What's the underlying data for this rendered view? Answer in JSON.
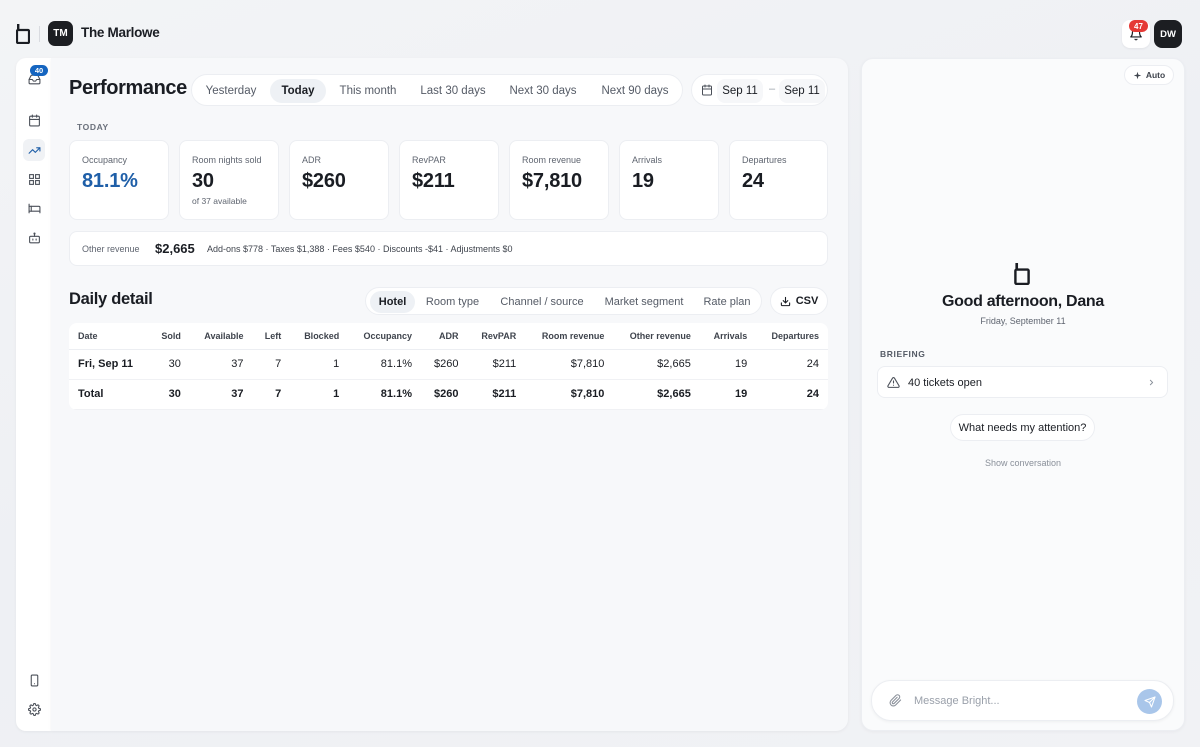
{
  "topbar": {
    "workspace_initials": "TM",
    "workspace_name": "The Marlowe",
    "notifications_count": "47",
    "user_initials": "DW"
  },
  "rail": {
    "inbox_badge": "40",
    "items": [
      "inbox-icon",
      "calendar-icon",
      "trending-up-icon",
      "grid-icon",
      "bed-icon",
      "robot-icon"
    ],
    "bottom_items": [
      "mobile-icon",
      "gear-icon"
    ]
  },
  "header": {
    "title": "Performance",
    "range_tabs": [
      "Yesterday",
      "Today",
      "This month",
      "Last 30 days",
      "Next 30 days",
      "Next 90 days"
    ],
    "active_range": "Today",
    "date_from": "Sep 11",
    "date_sep": "–",
    "date_to": "Sep 11"
  },
  "summary": {
    "section_label": "TODAY",
    "cards": [
      {
        "label": "Occupancy",
        "value": "81.1%"
      },
      {
        "label": "Room nights sold",
        "value": "30",
        "sub": "of 37 available"
      },
      {
        "label": "ADR",
        "value": "$260"
      },
      {
        "label": "RevPAR",
        "value": "$211"
      },
      {
        "label": "Room revenue",
        "value": "$7,810"
      },
      {
        "label": "Arrivals",
        "value": "19"
      },
      {
        "label": "Departures",
        "value": "24"
      }
    ],
    "other_revenue": {
      "label": "Other revenue",
      "amount": "$2,665",
      "breakdown": "Add-ons $778 · Taxes $1,388 · Fees $540 · Discounts -$41 · Adjustments $0"
    }
  },
  "detail": {
    "title": "Daily detail",
    "group_tabs": [
      "Hotel",
      "Room type",
      "Channel / source",
      "Market segment",
      "Rate plan"
    ],
    "active_group": "Hotel",
    "csv_label": "CSV",
    "columns": [
      "Date",
      "Sold",
      "Available",
      "Left",
      "Blocked",
      "Occupancy",
      "ADR",
      "RevPAR",
      "Room revenue",
      "Other revenue",
      "Arrivals",
      "Departures"
    ],
    "rows": [
      [
        "Fri, Sep 11",
        "30",
        "37",
        "7",
        "1",
        "81.1%",
        "$260",
        "$211",
        "$7,810",
        "$2,665",
        "19",
        "24"
      ]
    ],
    "total": [
      "Total",
      "30",
      "37",
      "7",
      "1",
      "81.1%",
      "$260",
      "$211",
      "$7,810",
      "$2,665",
      "19",
      "24"
    ]
  },
  "assistant": {
    "auto_label": "Auto",
    "greeting": "Good afternoon, Dana",
    "date": "Friday, September 11",
    "briefing_label": "BRIEFING",
    "tickets_text": "40 tickets open",
    "suggestion": "What needs my attention?",
    "show_conversation": "Show conversation",
    "composer_placeholder": "Message Bright..."
  }
}
